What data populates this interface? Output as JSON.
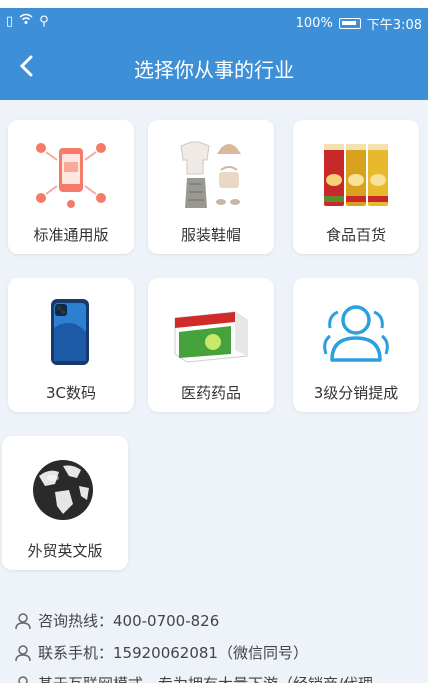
{
  "status_bar": {
    "battery": "100%",
    "time": "下午3:08"
  },
  "header": {
    "title": "选择你从事的行业"
  },
  "industries": [
    {
      "label": "标准通用版",
      "icon": "people-network-phone-icon"
    },
    {
      "label": "服装鞋帽",
      "icon": "clothing-items-icon"
    },
    {
      "label": "食品百货",
      "icon": "snack-cans-icon"
    },
    {
      "label": "3C数码",
      "icon": "smartphone-icon"
    },
    {
      "label": "医药药品",
      "icon": "medicine-box-icon"
    },
    {
      "label": "3级分销提成",
      "icon": "user-group-icon"
    },
    {
      "label": "外贸英文版",
      "icon": "globe-icon"
    }
  ],
  "contacts": [
    {
      "text": "咨询热线：400-0700-826",
      "icon": "user-icon"
    },
    {
      "text": "联系手机：15920062081（微信同号）",
      "icon": "user-icon"
    },
    {
      "text": "基于互联网模式，专为拥有大量下游（经销商/代理",
      "icon": "user-icon"
    }
  ]
}
